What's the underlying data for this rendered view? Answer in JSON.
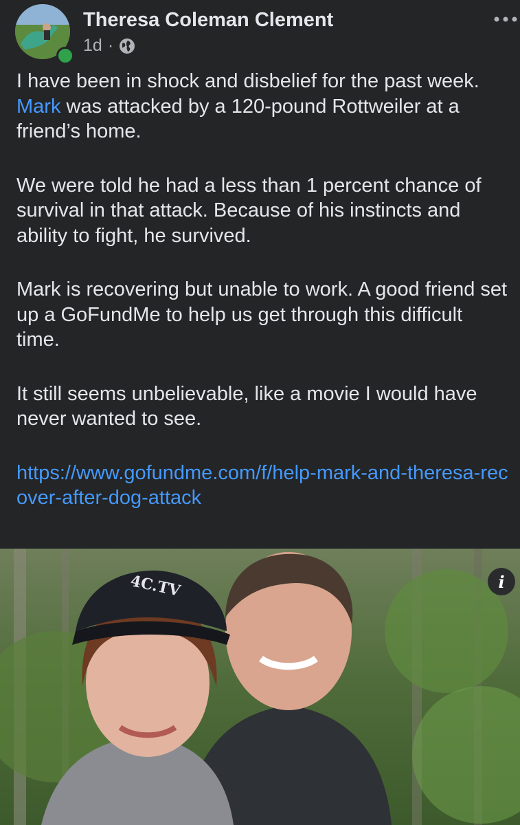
{
  "post": {
    "author": "Theresa Coleman Clement",
    "time": "1d",
    "separator": "·",
    "audience_icon": "globe-icon",
    "menu_icon": "more-horizontal-icon",
    "paragraphs": {
      "p1_mark": "Mark",
      "p1_before": "I have been in shock and disbelief for the past week. ",
      "p1_after": " was attacked by a 120-pound Rottweiler at a friend’s home.",
      "p2": "We were told he had a less than 1 percent chance of survival in that attack. Because of his instincts and ability to fight, he survived.",
      "p3": "Mark is recovering but unable to work. A good friend set up a GoFundMe to help us get through this difficult time.",
      "p4": "It still seems unbelievable, like a movie I would have never wanted to see."
    },
    "link": "https://www.gofundme.com/f/help-mark-and-theresa-recover-after-dog-attack",
    "photo": {
      "cap_text": "4C.TV",
      "info_icon": "i"
    }
  },
  "colors": {
    "background": "#242526",
    "text": "#e4e6eb",
    "muted": "#b0b3b8",
    "link": "#4599ff",
    "online": "#31a24c"
  }
}
